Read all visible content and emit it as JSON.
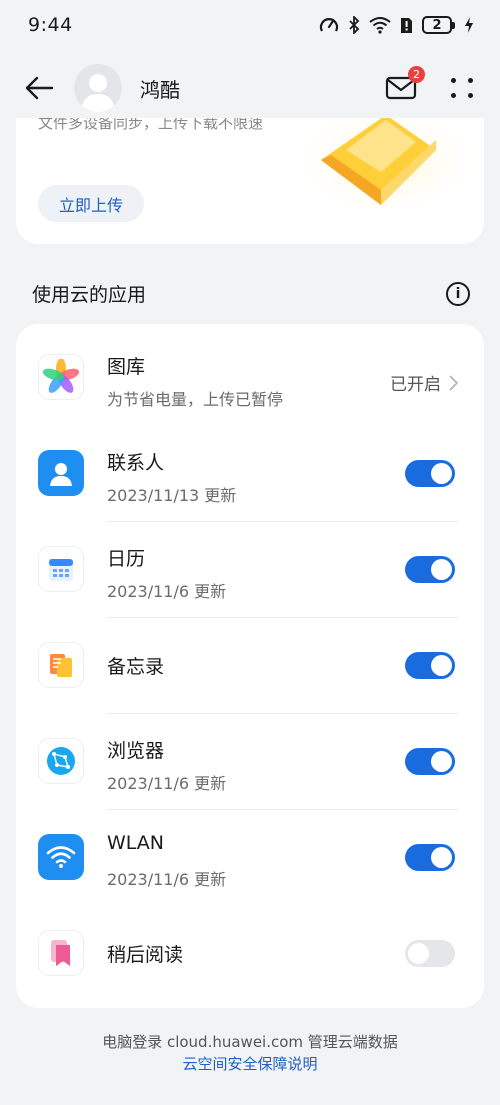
{
  "status_bar": {
    "time": "9:44",
    "battery_level": "2"
  },
  "header": {
    "user_name": "鸿酷",
    "mail_badge_count": "2"
  },
  "upload_card": {
    "partial_text": "文件多设备同步，上传下载不限速",
    "upload_button": "立即上传"
  },
  "apps_section": {
    "title": "使用云的应用",
    "items": [
      {
        "name": "图库",
        "subtitle": "为节省电量，上传已暂停",
        "status": "已开启",
        "icon": "gallery-icon"
      },
      {
        "name": "联系人",
        "subtitle": "2023/11/13 更新",
        "enabled": true,
        "icon": "contacts-icon"
      },
      {
        "name": "日历",
        "subtitle": "2023/11/6 更新",
        "enabled": true,
        "icon": "calendar-icon"
      },
      {
        "name": "备忘录",
        "enabled": true,
        "icon": "notes-icon"
      },
      {
        "name": "浏览器",
        "subtitle": "2023/11/6 更新",
        "enabled": true,
        "icon": "browser-icon"
      },
      {
        "name": "WLAN",
        "subtitle": "2023/11/6 更新",
        "enabled": true,
        "icon": "wlan-icon"
      },
      {
        "name": "稍后阅读",
        "enabled": false,
        "icon": "read-later-icon"
      }
    ]
  },
  "footer": {
    "line1": "电脑登录 cloud.huawei.com 管理云端数据",
    "link": "云空间安全保障说明"
  },
  "colors": {
    "accent": "#1b6be0",
    "link": "#1f5fc6",
    "background": "#f1f3f5",
    "badge": "#e8413f"
  }
}
